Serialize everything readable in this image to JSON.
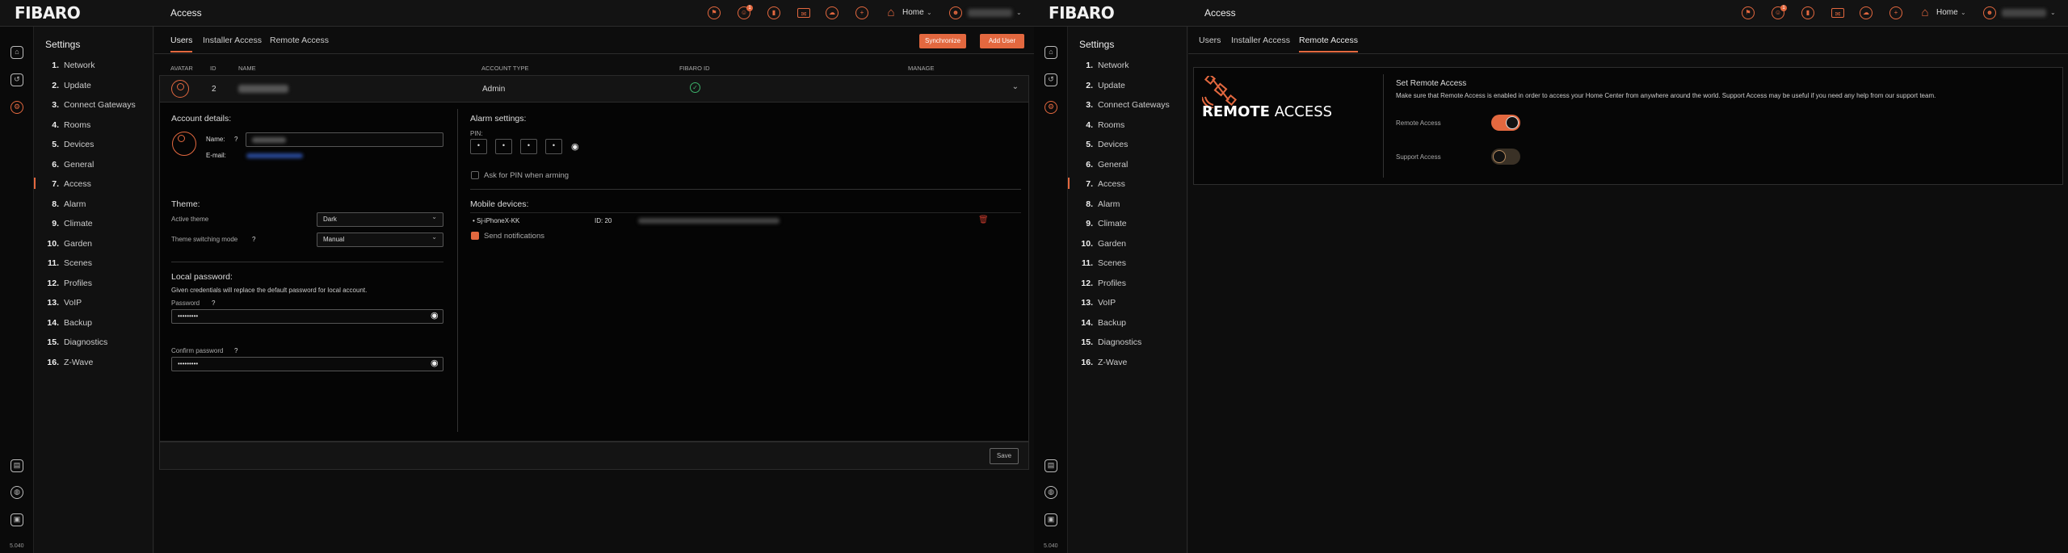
{
  "version": "5.040",
  "brand": "FIBARO",
  "topbar": {
    "home_label": "Home",
    "notification_badge": "1"
  },
  "sidebar": {
    "title": "Settings",
    "items": [
      {
        "num": "1.",
        "label": "Network"
      },
      {
        "num": "2.",
        "label": "Update"
      },
      {
        "num": "3.",
        "label": "Connect Gateways"
      },
      {
        "num": "4.",
        "label": "Rooms"
      },
      {
        "num": "5.",
        "label": "Devices"
      },
      {
        "num": "6.",
        "label": "General"
      },
      {
        "num": "7.",
        "label": "Access"
      },
      {
        "num": "8.",
        "label": "Alarm"
      },
      {
        "num": "9.",
        "label": "Climate"
      },
      {
        "num": "10.",
        "label": "Garden"
      },
      {
        "num": "11.",
        "label": "Scenes"
      },
      {
        "num": "12.",
        "label": "Profiles"
      },
      {
        "num": "13.",
        "label": "VoIP"
      },
      {
        "num": "14.",
        "label": "Backup"
      },
      {
        "num": "15.",
        "label": "Diagnostics"
      },
      {
        "num": "16.",
        "label": "Z-Wave"
      }
    ],
    "active_index": 6
  },
  "left": {
    "title": "Access",
    "tabs": [
      "Users",
      "Installer Access",
      "Remote Access"
    ],
    "active_tab": 0,
    "buttons": {
      "synchronize": "Synchronize",
      "add_user": "Add User"
    },
    "table_headers": {
      "avatar": "AVATAR",
      "id": "ID",
      "name": "NAME",
      "account_type": "ACCOUNT TYPE",
      "fibaro_id": "FIBARO ID",
      "manage": "MANAGE"
    },
    "user": {
      "id": "2",
      "account_type": "Admin"
    },
    "account": {
      "title": "Account details:",
      "name_label": "Name:",
      "email_label": "E-mail:",
      "help": "?"
    },
    "theme": {
      "title": "Theme:",
      "active_theme_label": "Active theme",
      "active_theme_value": "Dark",
      "switching_label": "Theme switching mode",
      "switching_value": "Manual"
    },
    "local_password": {
      "title": "Local password:",
      "note": "Given credentials will replace the default password for local account.",
      "password_label": "Password",
      "password_value": "•••••••••",
      "confirm_label": "Confirm password",
      "confirm_value": "•••••••••"
    },
    "alarm": {
      "title": "Alarm settings:",
      "pin_label": "PIN:",
      "pin_digits": [
        "•",
        "•",
        "•",
        "•"
      ],
      "ask_pin_label": "Ask for PIN when arming",
      "ask_pin_checked": false
    },
    "mobile": {
      "title": "Mobile devices:",
      "device_name": "• Sj-iPhoneX-KK",
      "device_id": "ID: 20",
      "send_notifications_label": "Send notifications",
      "send_notifications_checked": true
    },
    "save_label": "Save"
  },
  "right": {
    "title": "Access",
    "tabs": [
      "Users",
      "Installer Access",
      "Remote Access"
    ],
    "active_tab": 2,
    "remote": {
      "logo_word1": "REMOTE",
      "logo_word2": "ACCESS",
      "section_title": "Set Remote Access",
      "description": "Make sure that Remote Access is enabled in order to access your Home Center from anywhere around the world. Support Access may be useful if you need any help from our support team.",
      "remote_access_label": "Remote Access",
      "remote_access_on": true,
      "support_access_label": "Support Access",
      "support_access_on": false
    }
  },
  "colors": {
    "accent": "#e3683f",
    "background": "#0d0d0d",
    "toggle_off": "#3a3126"
  }
}
